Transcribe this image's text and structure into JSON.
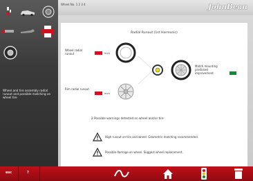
{
  "header": {
    "vehicle_label": "Wheel No. 1 2 3 4",
    "brand": "JohnBean"
  },
  "sidebar": {
    "description": "Wheel and tire assembly radial runout and possible matching on wheel tire"
  },
  "panel": {
    "title": "Radial Runout (1st Harmonic)",
    "wheel_radial_runout_label": "Wheel radial runout",
    "wheel_unit": "inch",
    "rim_radial_runout_label": "Rim radial runout",
    "rim_unit": "inch",
    "match_label": "Match mounting predicted improvement",
    "warnings_heading": "2 Possible warnings detected on wheel and/or tire",
    "warnings": [
      "High runout on tire and wheel. Geometric matching recommended.",
      "Possible damage on wheel. Suggest wheel replacement."
    ]
  },
  "bottom_bar": {
    "esc_label": "esc",
    "help_label": "?"
  },
  "colors": {
    "accent_red": "#d2111b",
    "ok_green": "#0e8a3a"
  },
  "icons": [
    "car-wheel-icon",
    "wrench-icon",
    "printer-icon",
    "tire-icon",
    "warning-icon",
    "home-icon",
    "runout-graph-icon",
    "traffic-light-icon",
    "trash-icon"
  ]
}
